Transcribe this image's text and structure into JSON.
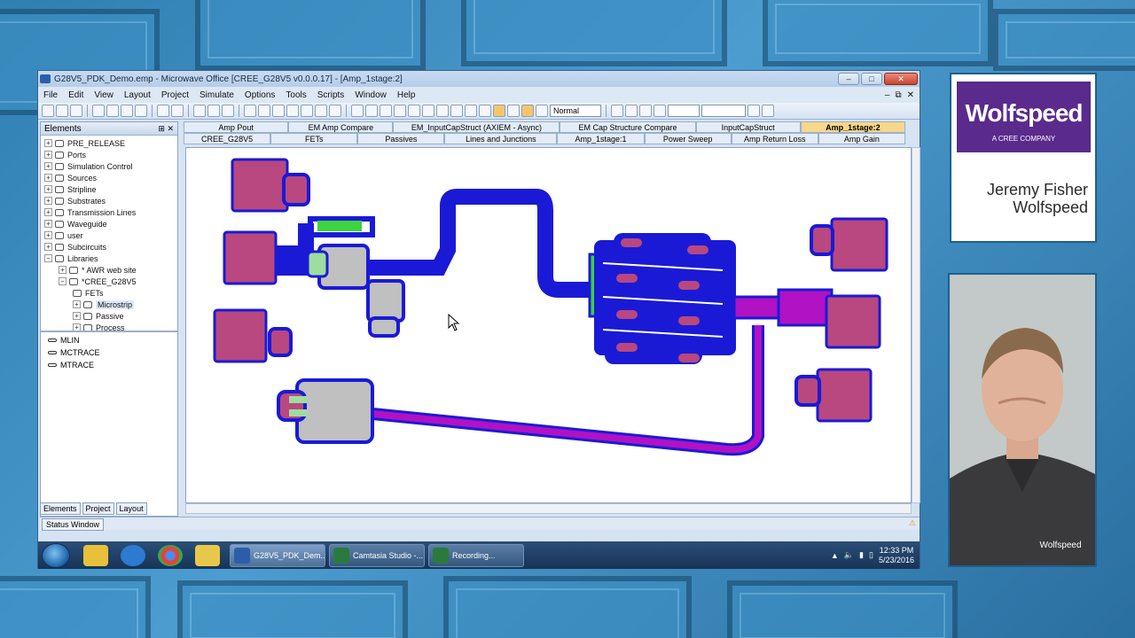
{
  "app": {
    "title": "G28V5_PDK_Demo.emp - Microwave Office [CREE_G28V5 v0.0.0.17] - [Amp_1stage:2]",
    "menu": [
      "File",
      "Edit",
      "View",
      "Layout",
      "Project",
      "Simulate",
      "Options",
      "Tools",
      "Scripts",
      "Window",
      "Help"
    ],
    "zoom_mode": "Normal"
  },
  "elements_pane": {
    "title": "Elements",
    "tree": [
      {
        "label": "PRE_RELEASE",
        "indent": 0
      },
      {
        "label": "Ports",
        "indent": 0
      },
      {
        "label": "Simulation Control",
        "indent": 0
      },
      {
        "label": "Sources",
        "indent": 0
      },
      {
        "label": "Stripline",
        "indent": 0
      },
      {
        "label": "Substrates",
        "indent": 0
      },
      {
        "label": "Transmission Lines",
        "indent": 0
      },
      {
        "label": "Waveguide",
        "indent": 0
      },
      {
        "label": "user",
        "indent": 0
      },
      {
        "label": "Subcircuits",
        "indent": 0
      },
      {
        "label": "Libraries",
        "indent": 0
      },
      {
        "label": "* AWR web site",
        "indent": 1
      },
      {
        "label": "*CREE_G28V5",
        "indent": 1
      },
      {
        "label": "FETs",
        "indent": 2
      },
      {
        "label": "Microstrip",
        "indent": 2
      },
      {
        "label": "Passive",
        "indent": 2
      },
      {
        "label": "Process",
        "indent": 2
      }
    ],
    "element_list": [
      "MLIN",
      "MCTRACE",
      "MTRACE"
    ],
    "bottom_tabs": [
      "Elements",
      "Project",
      "Layout"
    ]
  },
  "doc_tabs_row1": [
    "Amp Pout",
    "EM Amp Compare",
    "EM_InputCapStruct (AXIEM - Async)",
    "EM Cap Structure Compare",
    "InputCapStruct",
    "Amp_1stage:2"
  ],
  "doc_tabs_row2": [
    "CREE_G28V5",
    "FETs",
    "Passives",
    "Lines and Junctions",
    "Amp_1stage:1",
    "Power Sweep",
    "Amp Return Loss",
    "Amp Gain"
  ],
  "status_window": "Status Window",
  "taskbar": {
    "tasks": [
      "G28V5_PDK_Dem...",
      "Camtasia Studio -...",
      "Recording..."
    ],
    "time": "12:33 PM",
    "date": "5/23/2016"
  },
  "overlay": {
    "brand": "Wolfspeed",
    "brand_sub": "A CREE COMPANY",
    "presenter_name": "Jeremy Fisher",
    "presenter_company": "Wolfspeed",
    "shirt_logo": "Wolfspeed"
  },
  "colors": {
    "pad": "#b8487f",
    "trace": "#1a1ad6",
    "cap": "#c0c0c0",
    "line_magenta": "#b012c4",
    "green": "#3cd43c"
  }
}
